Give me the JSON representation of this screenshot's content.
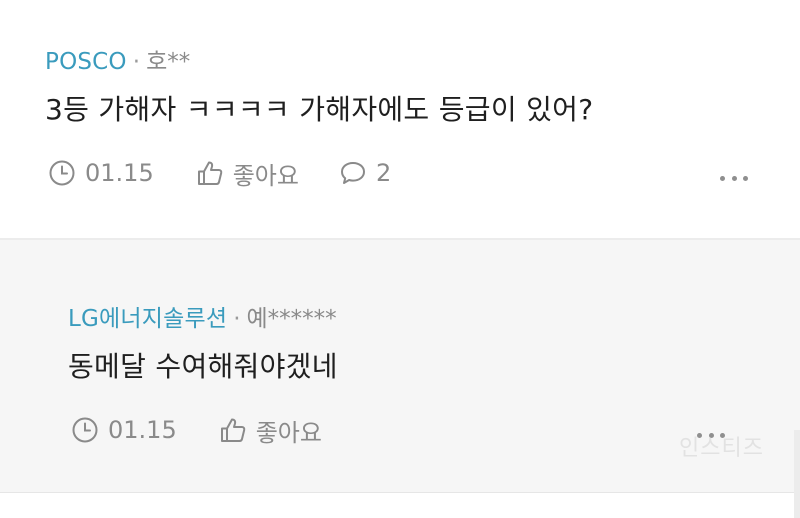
{
  "comments": [
    {
      "company": "POSCO",
      "separator": "·",
      "user": "호**",
      "text": "3등 가해자 ㅋㅋㅋㅋ 가해자에도 등급이 있어?",
      "date": "01.15",
      "like_label": "좋아요",
      "reply_count": "2",
      "icons": [
        "clock-icon",
        "thumbs-up-icon",
        "speech-bubble-icon",
        "more-icon"
      ]
    },
    {
      "company": "LG에너지솔루션",
      "separator": "·",
      "user": "예******",
      "text": "동메달 수여해줘야겠네",
      "date": "01.15",
      "like_label": "좋아요",
      "icons": [
        "clock-icon",
        "thumbs-up-icon",
        "more-icon"
      ]
    }
  ],
  "watermark": "인스티즈",
  "colors": {
    "company": "#3a9bbd",
    "meta": "#8a8a8a",
    "reply_background": "#f6f6f6"
  }
}
